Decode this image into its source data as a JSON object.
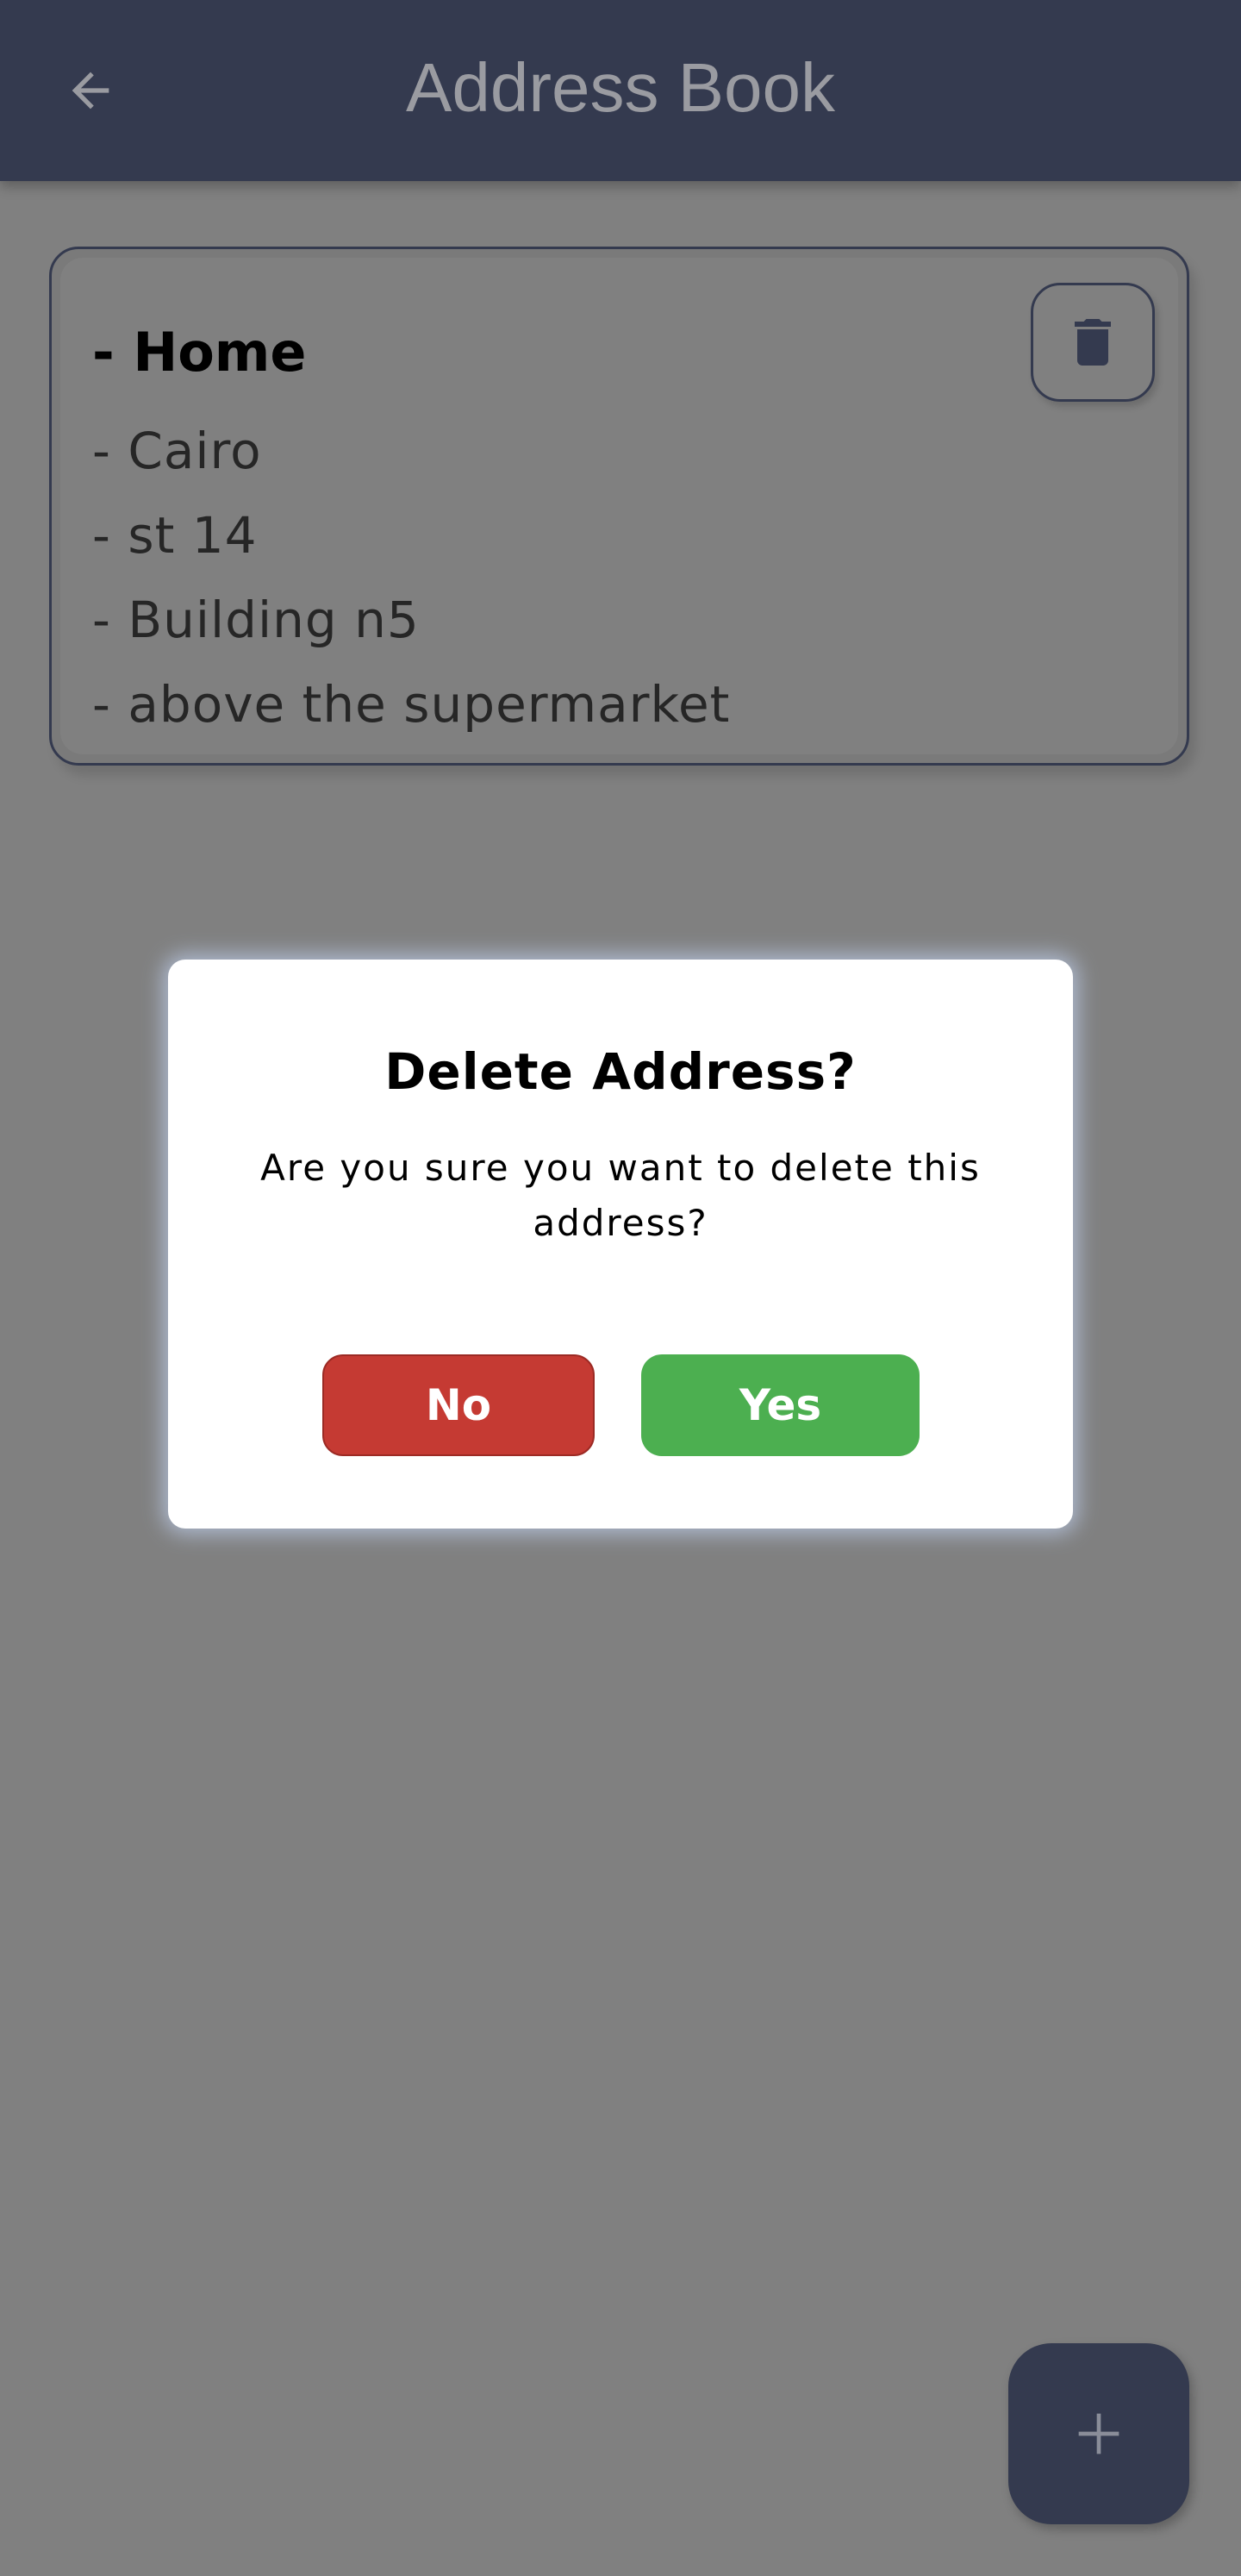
{
  "app_bar": {
    "title": "Address Book",
    "back_icon": "arrow-left-icon"
  },
  "address_card": {
    "title": "- Home",
    "lines": [
      "- Cairo",
      "- st 14",
      "- Building n5",
      "- above the supermarket"
    ],
    "delete_icon": "trash-icon"
  },
  "fab": {
    "icon": "plus-icon"
  },
  "dialog": {
    "title": "Delete Address?",
    "message": "Are you sure you want to delete this address?",
    "no_label": "No",
    "yes_label": "Yes"
  },
  "colors": {
    "app_bar": "#343a4f",
    "scrim": "#808080",
    "no_button": "#c53a33",
    "yes_button": "#4caf50",
    "dialog_background": "#ffffff"
  }
}
